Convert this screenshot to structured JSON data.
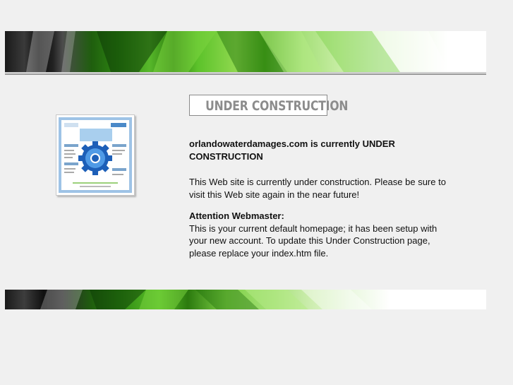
{
  "header": {
    "banner_name": "green-banner"
  },
  "badge": {
    "label": "UNDER CONSTRUCTION"
  },
  "content": {
    "lead": "orlandowaterdamages.com is currently UNDER CONSTRUCTION",
    "paragraph1": "This Web site is currently under construction. Please be sure to visit this Web site again in the near future!",
    "attention_title": "Attention Webmaster:",
    "attention_body": "This is your current default homepage; it has been setup with your new account. To update this Under Construction page, please replace your index.htm file."
  },
  "colors": {
    "background": "#f0f0f0",
    "banner_green": "#4ca81c",
    "badge_text": "#8c8c8c"
  },
  "icons": {
    "thumbnail": "website-gear-icon"
  }
}
